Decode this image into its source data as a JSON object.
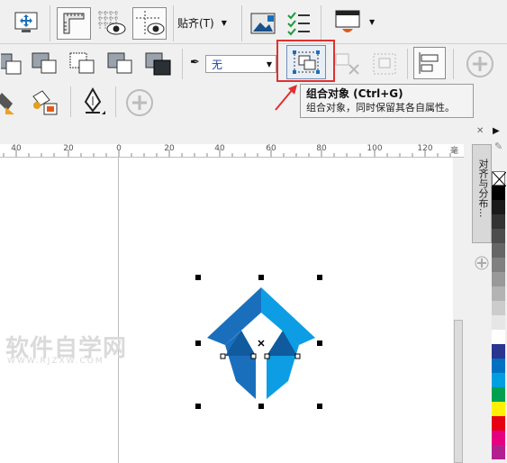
{
  "toolbar": {
    "snap_label": "贴齐(T)",
    "outline_value": "无"
  },
  "tooltip": {
    "title": "组合对象 (Ctrl+G)",
    "description": "组合对象，同时保留其各自属性。"
  },
  "ruler": {
    "ticks": [
      "40",
      "20",
      "0",
      "20",
      "40",
      "60",
      "80",
      "100",
      "120"
    ],
    "unit": "毫米"
  },
  "docker": {
    "title": "对齐与分布..."
  },
  "watermark": {
    "main": "软件自学网",
    "sub": "WWW.RJZXW.COM"
  },
  "colors": {
    "logo_dark": "#1a6fbd",
    "logo_light": "#0d9de4",
    "logo_deep": "#105a9e",
    "highlight": "#e03030"
  },
  "palette": [
    "#ffffff",
    "#000000",
    "#1a1a1a",
    "#333333",
    "#4d4d4d",
    "#666666",
    "#808080",
    "#999999",
    "#b3b3b3",
    "#cccccc",
    "#e6e6e6",
    "#ffffff",
    "#2a3590",
    "#0070c0",
    "#00a0e0",
    "#00a050",
    "#ffef00",
    "#e60012",
    "#e4007f",
    "#b22090"
  ]
}
